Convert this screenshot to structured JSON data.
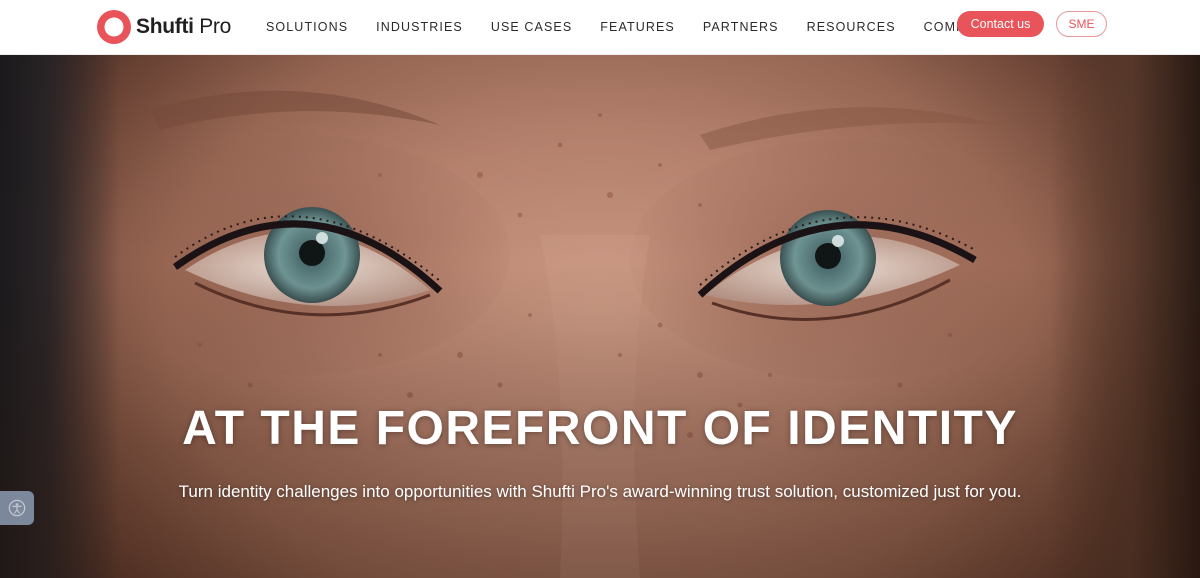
{
  "brand": {
    "name_bold": "Shufti",
    "name_light": " Pro",
    "accent_color": "#e85459",
    "icon": "shufti-pro-logo-icon"
  },
  "nav": {
    "items": [
      {
        "label": "SOLUTIONS"
      },
      {
        "label": "INDUSTRIES"
      },
      {
        "label": "USE CASES"
      },
      {
        "label": "FEATURES"
      },
      {
        "label": "PARTNERS"
      },
      {
        "label": "RESOURCES"
      },
      {
        "label": "COMPANY"
      }
    ],
    "contact_label": "Contact us",
    "sme_label": "SME"
  },
  "hero": {
    "title": "AT THE FOREFRONT OF IDENTITY",
    "subtitle": "Turn identity challenges into opportunities with Shufti Pro's award-winning trust solution, customized just for you.",
    "background": "close-up-face-eyes-image"
  },
  "widgets": {
    "accessibility_icon": "accessibility-icon"
  }
}
